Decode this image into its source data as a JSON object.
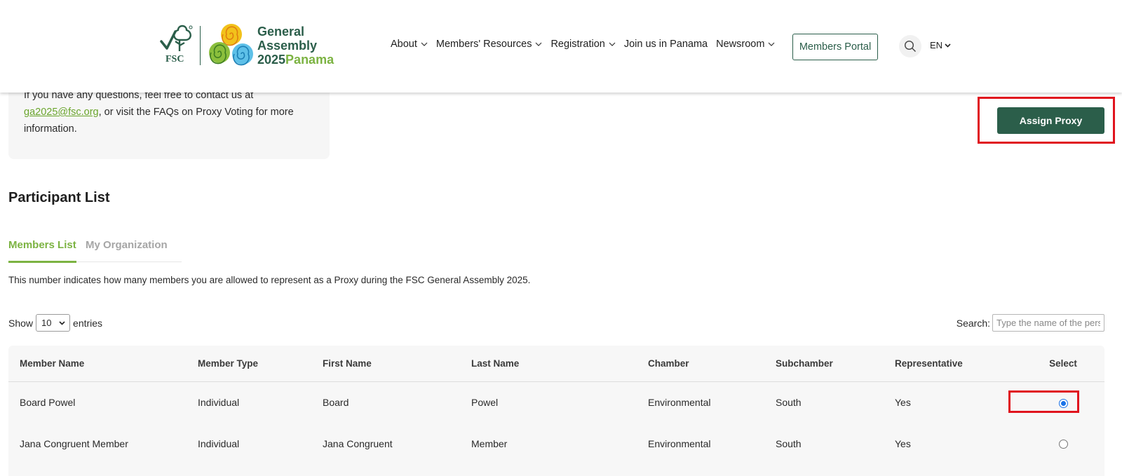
{
  "header": {
    "logo_line1": "General",
    "logo_line2": "Assembly",
    "logo_year": "2025",
    "logo_place": "Panama",
    "fsc_label": "FSC",
    "nav": [
      {
        "label": "About",
        "dropdown": true
      },
      {
        "label": "Members' Resources",
        "dropdown": true
      },
      {
        "label": "Registration",
        "dropdown": true
      },
      {
        "label": "Join us in Panama",
        "dropdown": false
      },
      {
        "label": "Newsroom",
        "dropdown": true
      }
    ],
    "portal_label": "Members Portal",
    "language": "EN"
  },
  "info": {
    "cut_line": "If you have any questions, feel free to contact us at",
    "email": "ga2025@fsc.org",
    "rest1": ", or visit the FAQs on Proxy Voting for more",
    "rest2": "information."
  },
  "assign_label": "Assign Proxy",
  "section_title": "Participant List",
  "tabs": [
    {
      "label": "Members List",
      "active": true
    },
    {
      "label": "My Organization",
      "active": false
    }
  ],
  "note": "This number indicates how many members you are allowed to represent as a Proxy during the FSC General Assembly 2025.",
  "length": {
    "show_label": "Show",
    "value": "10",
    "entries_label": "entries"
  },
  "search": {
    "label": "Search:",
    "placeholder": "Type the name of the person"
  },
  "table": {
    "headers": [
      "Member Name",
      "Member Type",
      "First Name",
      "Last Name",
      "Chamber",
      "Subchamber",
      "Representative",
      "Select"
    ],
    "rows": [
      {
        "member_name": "Board Powel",
        "member_type": "Individual",
        "first_name": "Board",
        "last_name": "Powel",
        "chamber": "Environmental",
        "subchamber": "South",
        "representative": "Yes",
        "selected": true
      },
      {
        "member_name": "Jana Congruent Member",
        "member_type": "Individual",
        "first_name": "Jana Congruent",
        "last_name": "Member",
        "chamber": "Environmental",
        "subchamber": "South",
        "representative": "Yes",
        "selected": false
      }
    ]
  },
  "colors": {
    "brand_green": "#2b5e4a",
    "accent_green": "#7cb342",
    "highlight_red": "#e0141e",
    "radio_blue": "#1a73e8"
  }
}
